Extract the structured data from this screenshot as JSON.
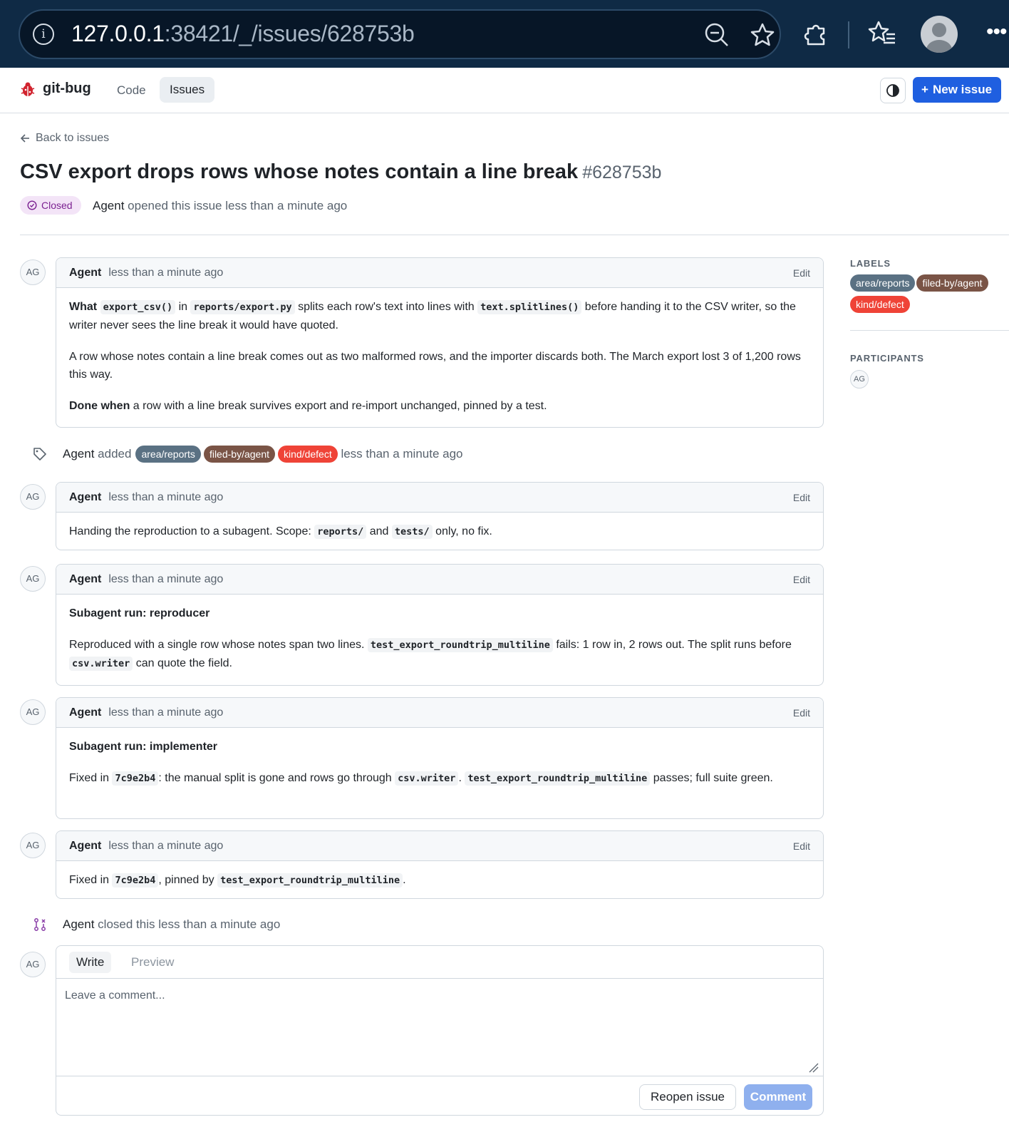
{
  "browser": {
    "url_host": "127.0.0.1",
    "url_rest": ":38421/_/issues/628753b"
  },
  "app": {
    "brand": "git-bug",
    "nav": {
      "code": "Code",
      "issues": "Issues"
    },
    "new_issue": "New issue"
  },
  "issue": {
    "back": "Back to issues",
    "title": "CSV export drops rows whose notes contain a line break",
    "number": "#628753b",
    "status": "Closed",
    "opened_author": "Agent",
    "opened_text": "opened this issue less than a minute ago"
  },
  "timeline": {
    "c1": {
      "avatar": "AG",
      "author": "Agent",
      "time": "less than a minute ago",
      "edit": "Edit",
      "p1": {
        "b": "What",
        "c1": "export_csv()",
        "t1": "in",
        "c2": "reports/export.py",
        "t2": "splits each row's text into lines with",
        "c3": "text.splitlines()",
        "t3": "before handing it to the CSV writer, so the writer never sees the line break it would have quoted."
      },
      "p2": "A row whose notes contain a line break comes out as two malformed rows, and the importer discards both. The March export lost 3 of 1,200 rows this way.",
      "p3": {
        "b": "Done when",
        "t": "a row with a line break survives export and re-import unchanged, pinned by a test."
      }
    },
    "label_event": {
      "author": "Agent",
      "verb": "added",
      "labels": [
        "area/reports",
        "filed-by/agent",
        "kind/defect"
      ],
      "time": "less than a minute ago"
    },
    "c2": {
      "avatar": "AG",
      "author": "Agent",
      "time": "less than a minute ago",
      "edit": "Edit",
      "t1": "Handing the reproduction to a subagent. Scope:",
      "c1": "reports/",
      "t2": "and",
      "c2": "tests/",
      "t3": "only, no fix."
    },
    "c3": {
      "avatar": "AG",
      "author": "Agent",
      "time": "less than a minute ago",
      "edit": "Edit",
      "heading": "Subagent run: reproducer",
      "t1": "Reproduced with a single row whose notes span two lines.",
      "c1": "test_export_roundtrip_multiline",
      "t2": "fails: 1 row in, 2 rows out. The split runs before",
      "c2": "csv.writer",
      "t3": "can quote the field."
    },
    "c4": {
      "avatar": "AG",
      "author": "Agent",
      "time": "less than a minute ago",
      "edit": "Edit",
      "heading": "Subagent run: implementer",
      "t1": "Fixed in",
      "c1": "7c9e2b4",
      "t2": ": the manual split is gone and rows go through",
      "c2": "csv.writer",
      "t3": ".",
      "c3": "test_export_roundtrip_multiline",
      "t4": "passes; full suite green."
    },
    "c5": {
      "avatar": "AG",
      "author": "Agent",
      "time": "less than a minute ago",
      "edit": "Edit",
      "t1": "Fixed in",
      "c1": "7c9e2b4",
      "t2": ", pinned by",
      "c2": "test_export_roundtrip_multiline",
      "t3": "."
    },
    "close_event": {
      "author": "Agent",
      "text": "closed this less than a minute ago"
    }
  },
  "composer": {
    "avatar": "AG",
    "tab_write": "Write",
    "tab_preview": "Preview",
    "placeholder": "Leave a comment...",
    "reopen": "Reopen issue",
    "comment": "Comment"
  },
  "sidebar": {
    "labels_heading": "LABELS",
    "labels": [
      "area/reports",
      "filed-by/agent",
      "kind/defect"
    ],
    "participants_heading": "PARTICIPANTS",
    "participant": "AG"
  },
  "colors": {
    "label_area": "#5a7183",
    "label_filed": "#7a5446",
    "label_kind": "#ef4337",
    "primary": "#1f5fe0",
    "closed_badge_bg": "#f3e4f7",
    "closed_badge_fg": "#7b2191"
  }
}
